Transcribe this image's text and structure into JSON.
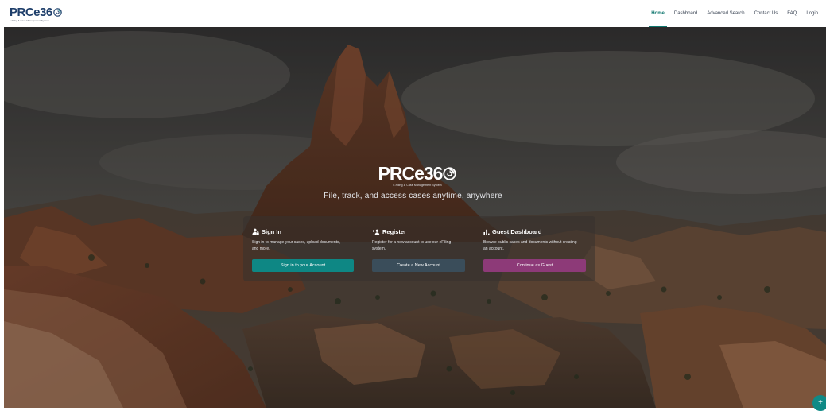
{
  "brand": {
    "name": "PRCe36",
    "tagline_small": "e-Filing & Case Management System",
    "logo_tag": "e-Filing & Case Management System"
  },
  "nav": {
    "items": [
      {
        "label": "Home",
        "active": true
      },
      {
        "label": "Dashboard",
        "active": false
      },
      {
        "label": "Advanced Search",
        "active": false
      },
      {
        "label": "Contact Us",
        "active": false
      },
      {
        "label": "FAQ",
        "active": false
      },
      {
        "label": "Login",
        "active": false
      }
    ]
  },
  "hero": {
    "tagline": "File, track, and access cases anytime, anywhere"
  },
  "cards": {
    "signin": {
      "icon": "user-lock-icon",
      "title": "Sign In",
      "description": "Sign in to manage your cases, upload documents, and more.",
      "button": "Sign in to your Account"
    },
    "register": {
      "icon": "user-plus-icon",
      "title": "Register",
      "description": "Register for a new account to use our eFiling system.",
      "button": "Create a New Account"
    },
    "guest": {
      "icon": "bar-chart-icon",
      "title": "Guest Dashboard",
      "description": "Browse public cases and documents without creating an account.",
      "button": "Continue as Guest"
    }
  },
  "fab": {
    "label": "+"
  },
  "colors": {
    "accent": "#0f766e",
    "brand_navy": "#1f3f6b",
    "button_teal": "#0e8784",
    "button_dark": "#3a4d5a",
    "button_purple": "#8d3a78"
  }
}
